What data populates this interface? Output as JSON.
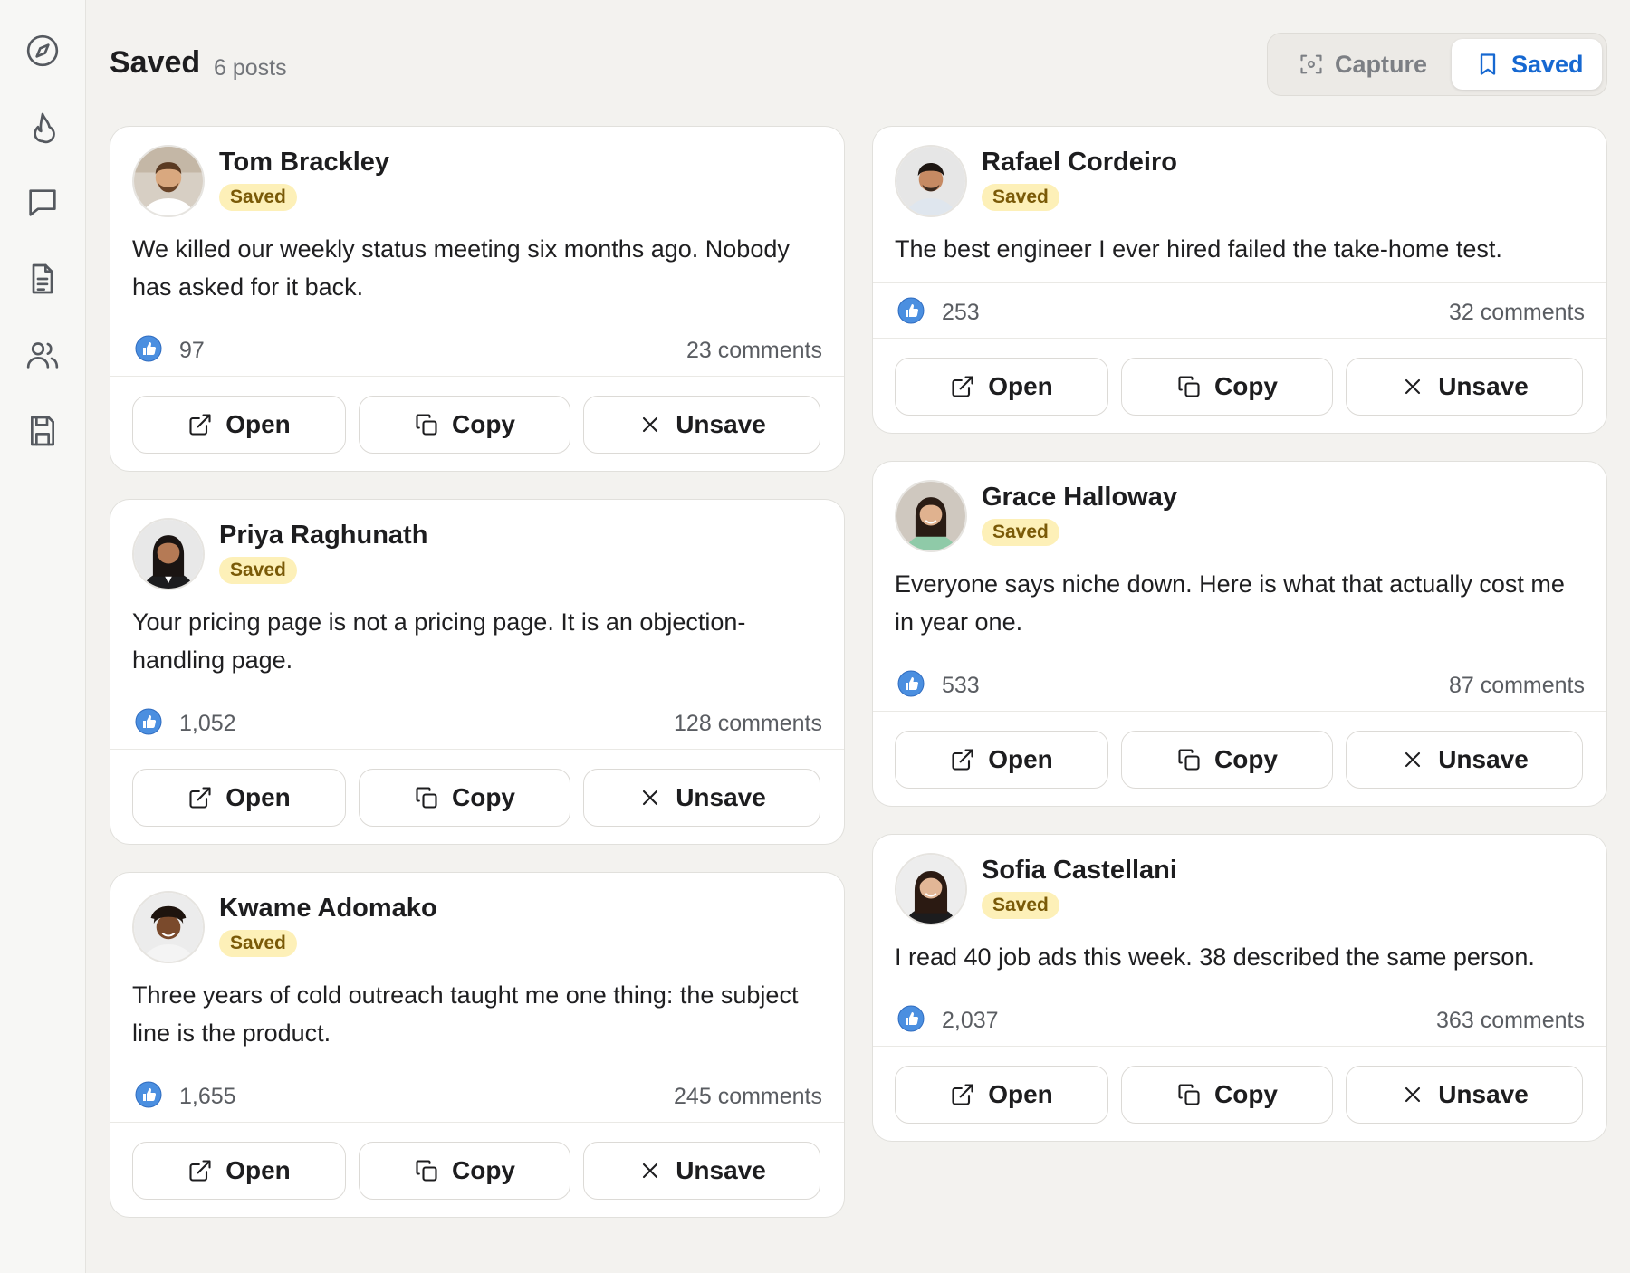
{
  "sidebar": {
    "items": [
      {
        "icon": "compass-icon"
      },
      {
        "icon": "flame-icon"
      },
      {
        "icon": "message-icon"
      },
      {
        "icon": "document-icon"
      },
      {
        "icon": "users-icon"
      },
      {
        "icon": "save-icon"
      }
    ]
  },
  "header": {
    "title": "Saved",
    "count": "6 posts"
  },
  "segmented": {
    "capture_label": "Capture",
    "saved_label": "Saved",
    "active": "Saved",
    "accent_color": "#1668d1"
  },
  "actions": {
    "open_label": "Open",
    "copy_label": "Copy",
    "unsave_label": "Unsave"
  },
  "posts": [
    {
      "author": "Tom Brackley",
      "badge": "Saved",
      "text": "We killed our weekly status meeting six months ago. Nobody has asked for it back.",
      "likes": "97",
      "comments": "23 comments"
    },
    {
      "author": "Priya Raghunath",
      "badge": "Saved",
      "text": "Your pricing page is not a pricing page. It is an objection-handling page.",
      "likes": "1,052",
      "comments": "128 comments"
    },
    {
      "author": "Kwame Adomako",
      "badge": "Saved",
      "text": "Three years of cold outreach taught me one thing: the subject line is the product.",
      "likes": "1,655",
      "comments": "245 comments"
    },
    {
      "author": "Rafael Cordeiro",
      "badge": "Saved",
      "text": "The best engineer I ever hired failed the take-home test.",
      "likes": "253",
      "comments": "32 comments"
    },
    {
      "author": "Grace Halloway",
      "badge": "Saved",
      "text": "Everyone says niche down. Here is what that actually cost me in year one.",
      "likes": "533",
      "comments": "87 comments"
    },
    {
      "author": "Sofia Castellani",
      "badge": "Saved",
      "text": "I read 40 job ads this week. 38 described the same person.",
      "likes": "2,037",
      "comments": "363 comments"
    }
  ]
}
